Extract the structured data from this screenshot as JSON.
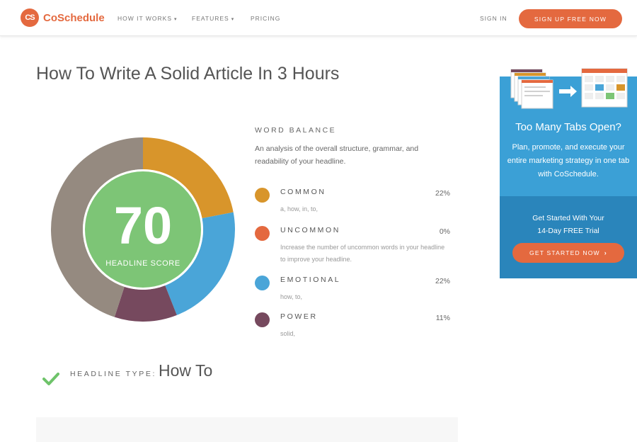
{
  "header": {
    "logo_mark": "CS",
    "logo_text": "CoSchedule",
    "nav": [
      {
        "label": "HOW IT WORKS",
        "caret": "▾"
      },
      {
        "label": "FEATURES",
        "caret": "▾"
      },
      {
        "label": "PRICING",
        "caret": ""
      }
    ],
    "signin": "SIGN IN",
    "signup": "SIGN UP FREE NOW"
  },
  "page_title": "How To Write A Solid Article In 3 Hours",
  "score": {
    "value": "70",
    "label": "HEADLINE SCORE",
    "segments": [
      {
        "name": "common",
        "fraction": 0.22,
        "color": "#d8952b"
      },
      {
        "name": "emotional",
        "fraction": 0.22,
        "color": "#4aa5d8"
      },
      {
        "name": "power",
        "fraction": 0.11,
        "color": "#76495e"
      },
      {
        "name": "other",
        "fraction": 0.45,
        "color": "#958a80"
      }
    ],
    "center_color": "#7dc576"
  },
  "word_balance": {
    "heading": "WORD BALANCE",
    "description": "An analysis of the overall structure, grammar, and readability of your headline.",
    "categories": [
      {
        "name": "COMMON",
        "percent": "22%",
        "words": "a, how, in, to,",
        "color": "#d8952b"
      },
      {
        "name": "UNCOMMON",
        "percent": "0%",
        "words": "Increase the number of uncommon words in your headline to improve your headline.",
        "color": "#e4693f"
      },
      {
        "name": "EMOTIONAL",
        "percent": "22%",
        "words": "how, to,",
        "color": "#4aa5d8"
      },
      {
        "name": "POWER",
        "percent": "11%",
        "words": "solid,",
        "color": "#76495e"
      }
    ]
  },
  "headline_type": {
    "label": "HEADLINE TYPE:",
    "value": "How To",
    "icon": "check-icon"
  },
  "ad": {
    "title": "Too Many Tabs Open?",
    "description": "Plan, promote, and execute your entire marketing strategy in one tab with CoSchedule.",
    "trial_line1": "Get Started With Your",
    "trial_line2": "14-Day FREE Trial",
    "button": "GET STARTED NOW",
    "button_icon": "chevron-right-icon"
  }
}
